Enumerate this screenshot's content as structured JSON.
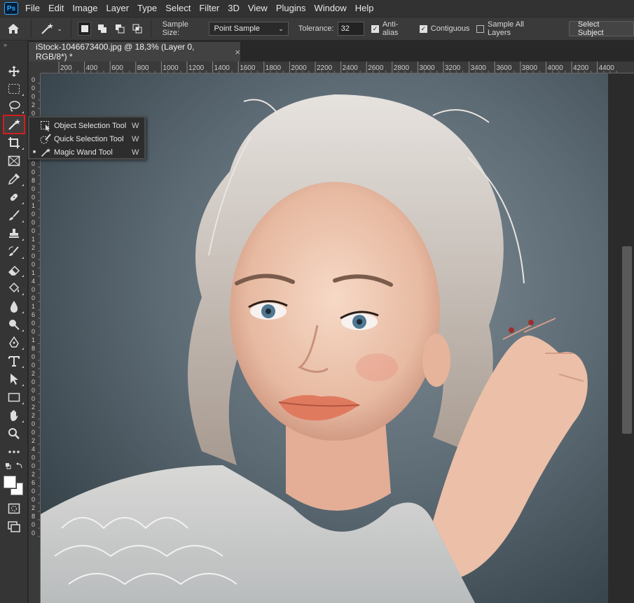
{
  "app": {
    "logo": "Ps"
  },
  "menu": [
    "File",
    "Edit",
    "Image",
    "Layer",
    "Type",
    "Select",
    "Filter",
    "3D",
    "View",
    "Plugins",
    "Window",
    "Help"
  ],
  "options": {
    "sample_size_label": "Sample Size:",
    "sample_size_value": "Point Sample",
    "tolerance_label": "Tolerance:",
    "tolerance_value": "32",
    "anti_alias": {
      "label": "Anti-alias",
      "checked": true
    },
    "contiguous": {
      "label": "Contiguous",
      "checked": true
    },
    "sample_all_layers": {
      "label": "Sample All Layers",
      "checked": false
    },
    "select_subject_label": "Select Subject"
  },
  "document": {
    "tab_title": "iStock-1046673400.jpg @ 18,3% (Layer 0, RGB/8*) *",
    "close": "×"
  },
  "ruler": {
    "h_ticks": [
      "200",
      "400",
      "600",
      "800",
      "1000",
      "1200",
      "1400",
      "1600",
      "1800",
      "2000",
      "2200",
      "2400",
      "2600",
      "2800",
      "3000",
      "3200",
      "3400",
      "3600",
      "3800",
      "4000",
      "4200",
      "4400"
    ],
    "v_ticks": [
      "0",
      "0",
      "0",
      "2",
      "0",
      "0",
      "4",
      "0",
      "0",
      "6",
      "0",
      "0",
      "8",
      "0",
      "0",
      "1",
      "0",
      "0",
      "0",
      "1",
      "2",
      "0",
      "0",
      "1",
      "4",
      "0",
      "0",
      "1",
      "6",
      "0",
      "0",
      "1",
      "8",
      "0",
      "0",
      "2",
      "0",
      "0",
      "0",
      "2",
      "2",
      "0",
      "0",
      "2",
      "4",
      "0",
      "0",
      "2",
      "6",
      "0",
      "0",
      "2",
      "8",
      "0",
      "0"
    ]
  },
  "flyout": [
    {
      "label": "Object Selection Tool",
      "key": "W",
      "active": false,
      "icon": "object-selection-icon"
    },
    {
      "label": "Quick Selection Tool",
      "key": "W",
      "active": false,
      "icon": "quick-selection-icon"
    },
    {
      "label": "Magic Wand Tool",
      "key": "W",
      "active": true,
      "icon": "magic-wand-icon"
    }
  ],
  "tools": [
    "move",
    "marquee",
    "lasso",
    "magic-wand",
    "crop",
    "frame",
    "eyedropper",
    "healing",
    "brush",
    "stamp",
    "history-brush",
    "eraser",
    "paint-bucket",
    "blur",
    "dodge",
    "pen",
    "type",
    "path-selection",
    "rectangle",
    "hand",
    "zoom",
    "more",
    "swap-colors",
    "color-swatches",
    "quick-mask",
    "screen-mode"
  ],
  "colors": {
    "accent_selected": "#d21d1d",
    "foreground": "#ffffff",
    "background": "#ffffff"
  }
}
